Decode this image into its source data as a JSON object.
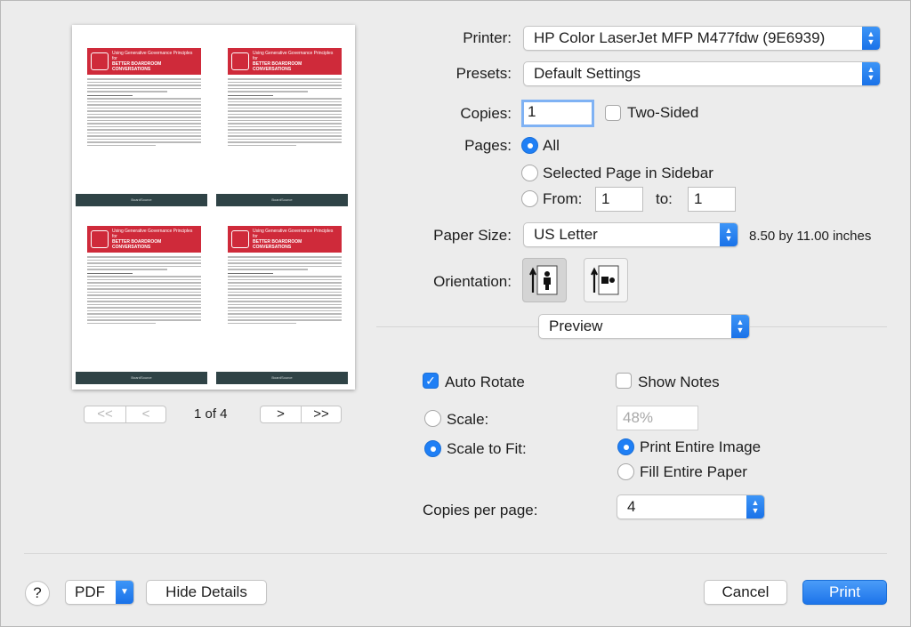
{
  "preview": {
    "page_label": "1 of 4",
    "mini_banner_title": "Using Generative Governance Principles for",
    "mini_banner_subtitle": "BETTER BOARDROOM CONVERSATIONS",
    "mini_section": "THREE MINDSETS",
    "mini_footer": "BoardSource",
    "nav_first": "<<",
    "nav_prev": "<",
    "nav_next": ">",
    "nav_last": ">>"
  },
  "printer": {
    "label": "Printer:",
    "value": "HP Color LaserJet MFP M477fdw (9E6939)"
  },
  "presets": {
    "label": "Presets:",
    "value": "Default Settings"
  },
  "copies": {
    "label": "Copies:",
    "value": "1",
    "two_sided": "Two-Sided"
  },
  "pages": {
    "label": "Pages:",
    "all": "All",
    "selected": "Selected Page in Sidebar",
    "from_label": "From:",
    "from_value": "1",
    "to_label": "to:",
    "to_value": "1"
  },
  "paper": {
    "label": "Paper Size:",
    "value": "US Letter",
    "dims": "8.50 by 11.00 inches"
  },
  "orientation": {
    "label": "Orientation:"
  },
  "section_popup": "Preview",
  "preview_opts": {
    "auto_rotate": "Auto Rotate",
    "show_notes": "Show Notes",
    "scale": "Scale:",
    "scale_value": "48%",
    "scale_to_fit": "Scale to Fit:",
    "print_entire": "Print Entire Image",
    "fill_entire": "Fill Entire Paper",
    "copies_per_page": "Copies per page:",
    "copies_per_page_value": "4"
  },
  "footer": {
    "help": "?",
    "pdf": "PDF",
    "hide_details": "Hide Details",
    "cancel": "Cancel",
    "print": "Print"
  },
  "colors": {
    "accent": "#1f7ff5",
    "banner_red": "#cf2a3a",
    "footer_teal": "#2f4346"
  }
}
